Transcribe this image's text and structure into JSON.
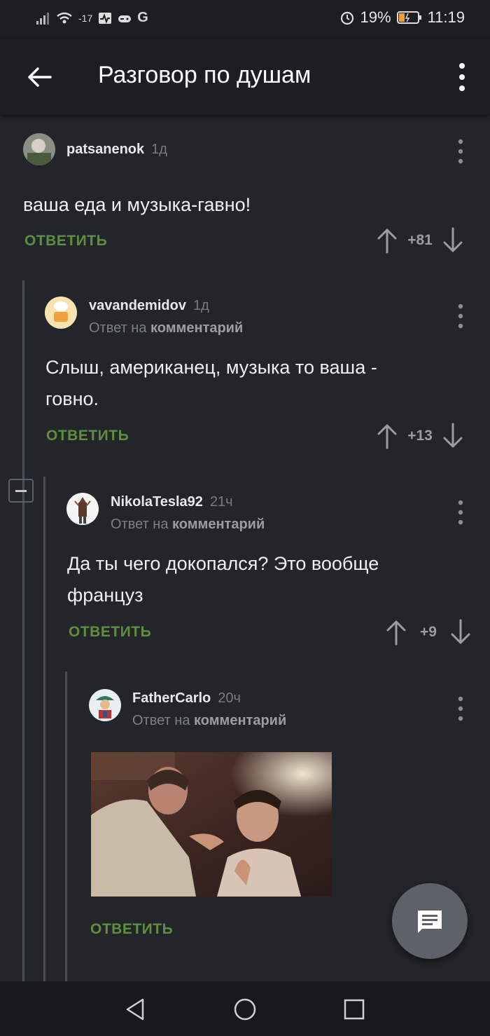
{
  "status_bar": {
    "signal_text": "-17",
    "carrier_icon": "G",
    "battery": "19%",
    "time": "11:19"
  },
  "app_bar": {
    "title": "Разговор по душам"
  },
  "reply_prefix": "Ответ на",
  "reply_target": "комментарий",
  "reply_label": "ОТВЕТИТЬ",
  "comments": [
    {
      "username": "patsanenok",
      "time": "1д",
      "text_lines": [
        "ваша еда и музыка-гавно!"
      ],
      "rating": "+81"
    },
    {
      "username": "vavandemidov",
      "time": "1д",
      "text_lines": [
        "Слыш, американец, музыка то ваша -",
        "говно."
      ],
      "rating": "+13"
    },
    {
      "username": "NikolaTesla92",
      "time": "21ч",
      "text_lines": [
        "Да ты чего докопался? Это вообще",
        "француз"
      ],
      "rating": "+9"
    },
    {
      "username": "FatherCarlo",
      "time": "20ч",
      "image": "photo-two-men-talking"
    }
  ],
  "icons": {
    "back": "arrow-left-icon",
    "overflow": "more-vert-icon",
    "upvote": "arrow-up-icon",
    "downvote": "arrow-down-icon",
    "fab": "comment-icon",
    "nav_back": "triangle-back-icon",
    "nav_home": "circle-home-icon",
    "nav_recent": "square-recent-icon"
  },
  "colors": {
    "background": "#22252a",
    "accent_green": "#5e8e3e",
    "muted": "#777b82"
  }
}
